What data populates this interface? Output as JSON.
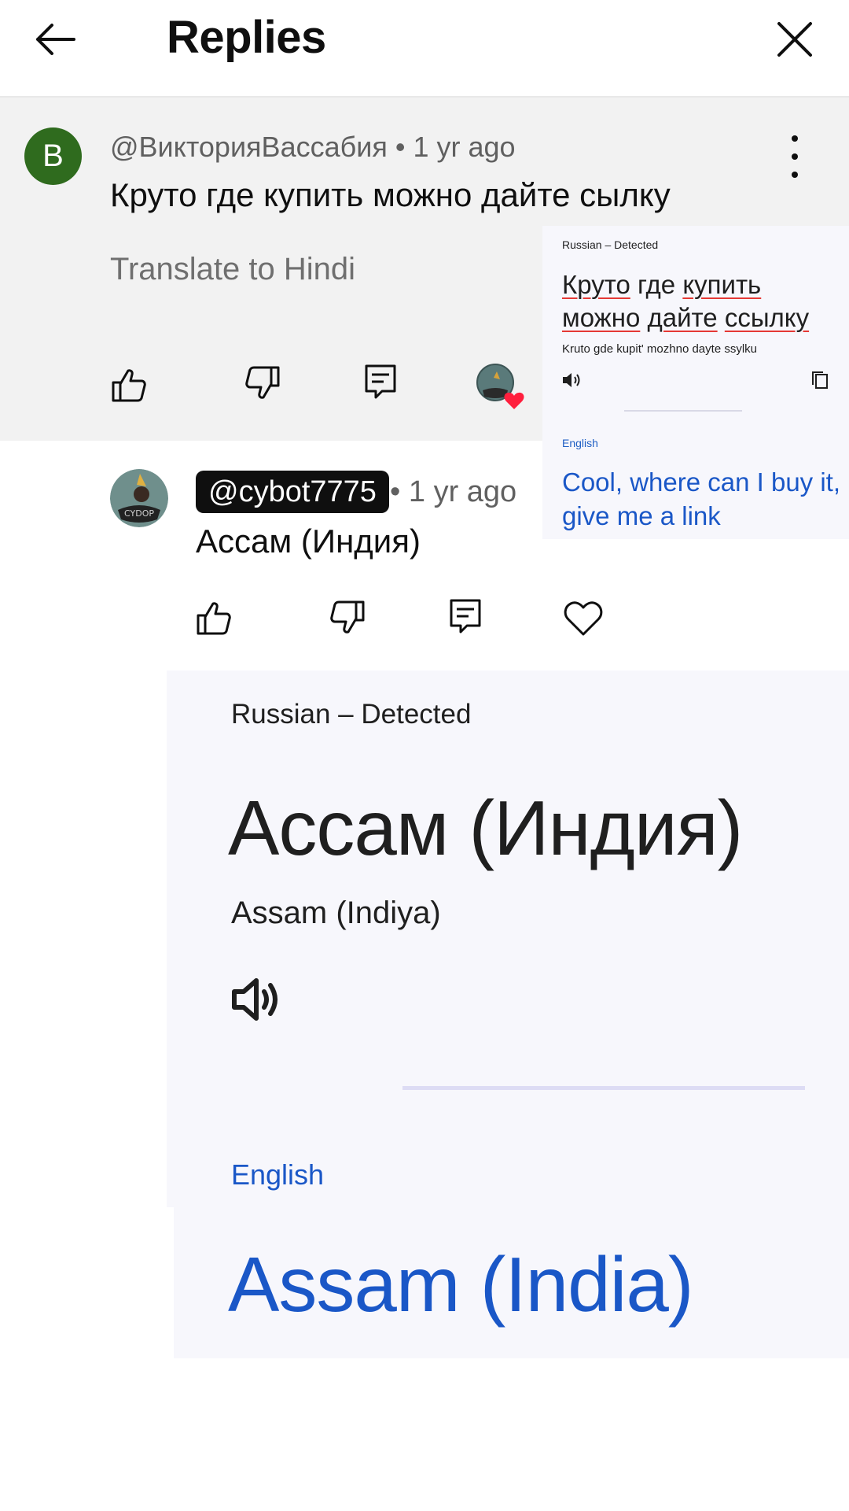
{
  "header": {
    "title": "Replies",
    "back_icon": "arrow-left-icon",
    "close_icon": "close-icon"
  },
  "parent_comment": {
    "avatar_letter": "B",
    "avatar_color": "#2f6b1e",
    "author": "@ВикторияВассабия",
    "time": "1 yr ago",
    "text": "Круто где купить можно дайте сылку",
    "translate_label": "Translate to Hindi"
  },
  "reply": {
    "author": "@cybot7775",
    "time": "1 yr ago",
    "text": "Ассам (Индия)"
  },
  "small_popup": {
    "detected": "Russian – Detected",
    "source_words": [
      "Круто",
      "где",
      "купить",
      "можно",
      "дайте",
      "ссылку"
    ],
    "transliteration": "Kruto gde kupit' mozhno dayte ssylku",
    "target_language": "English",
    "translation": "Cool, where can I buy it, give me a link"
  },
  "large_popup": {
    "detected": "Russian – Detected",
    "source": "Ассам (Индия)",
    "transliteration": "Assam (Indiya)",
    "target_language": "English",
    "translation": "Assam (India)"
  },
  "colors": {
    "accent_blue": "#1a57c7",
    "spellcheck_red": "#e53935",
    "heart_red": "#ff1f3d"
  }
}
